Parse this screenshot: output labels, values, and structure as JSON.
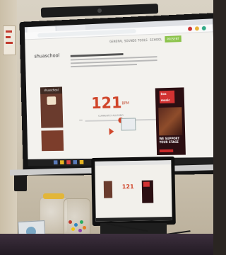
{
  "scene": {
    "board": {
      "brand_text": "shuaschool",
      "nav_items": [
        "GENERAL",
        "SOUNDS",
        "TOOLS",
        "SCHOOL"
      ],
      "nav_present": "PRESENT",
      "card_logo": "shuaschool",
      "bpm_value": "121",
      "bpm_unit": "BPM",
      "bpm_sub": "CURRENTLY ALLEGRO",
      "minus": "−",
      "plus": "+",
      "ad_logo_line1": "box",
      "ad_logo_line2": "music",
      "ad_cta": "WE SUPPORT YOUR STAGE"
    },
    "laptop": {
      "bpm_value": "121"
    }
  }
}
